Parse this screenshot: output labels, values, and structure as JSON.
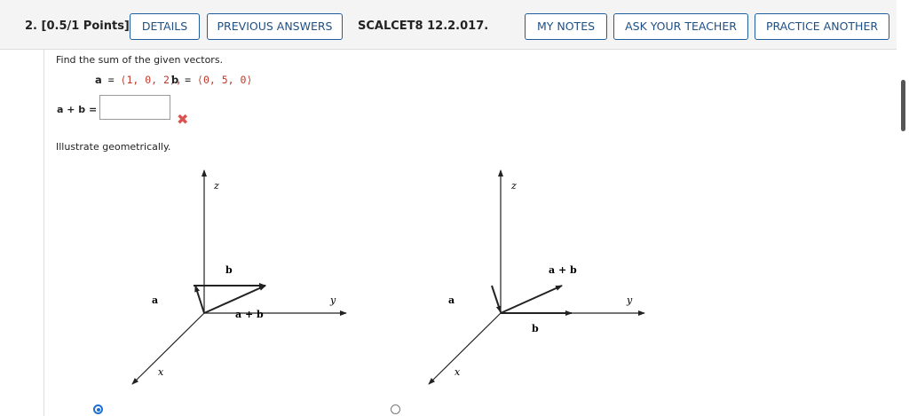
{
  "header": {
    "question_number": "2.",
    "points": "[0.5/1 Points]",
    "details_label": "DETAILS",
    "previous_answers_label": "PREVIOUS ANSWERS",
    "problem_code": "SCALCET8 12.2.017.",
    "my_notes_label": "MY NOTES",
    "ask_teacher_label": "ASK YOUR TEACHER",
    "practice_another_label": "PRACTICE ANOTHER"
  },
  "question": {
    "prompt": "Find the sum of the given vectors.",
    "vector_a_name": "a",
    "vector_a_value": "⟨1, 0, 2⟩,",
    "vector_b_name": "b",
    "vector_b_value": "⟨0, 5, 0⟩",
    "answer_label": "a + b =",
    "answer_value": "",
    "answer_status": "incorrect",
    "illustrate_text": "Illustrate geometrically."
  },
  "diagrams": [
    {
      "z": "z",
      "y": "y",
      "x": "x",
      "a": "a",
      "b": "b",
      "sum": "a + b",
      "selected": true
    },
    {
      "z": "z",
      "y": "y",
      "x": "x",
      "a": "a",
      "b": "b",
      "sum": "a + b",
      "selected": false
    }
  ],
  "colors": {
    "button_border": "#1f5d9c",
    "button_text": "#1f4f85",
    "vector_value": "#c0392b",
    "incorrect_mark": "#d9534f",
    "radio_selected": "#1f6fd1"
  }
}
